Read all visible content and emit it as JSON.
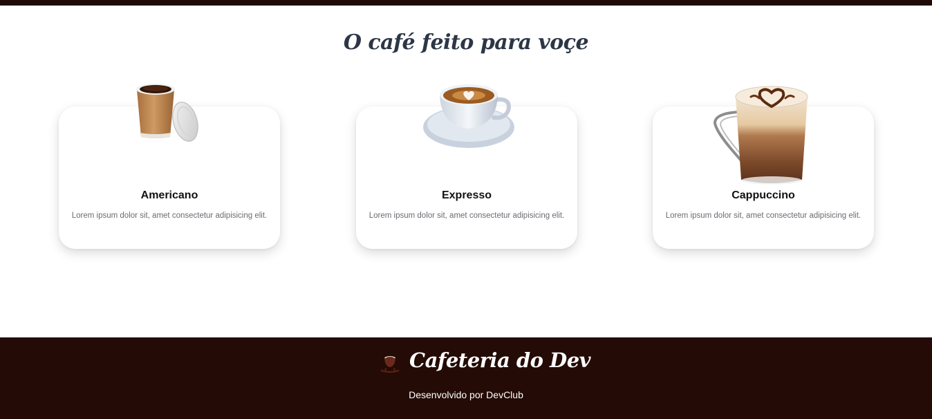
{
  "page": {
    "title": "O café feito para voçe"
  },
  "products": [
    {
      "name": "Americano",
      "description": "Lorem ipsum dolor sit, amet consectetur adipisicing elit.",
      "icon": "coffee-to-go-cup-icon"
    },
    {
      "name": "Expresso",
      "description": "Lorem ipsum dolor sit, amet consectetur adipisicing elit.",
      "icon": "coffee-cup-saucer-icon"
    },
    {
      "name": "Cappuccino",
      "description": "Lorem ipsum dolor sit, amet consectetur adipisicing elit.",
      "icon": "cappuccino-glass-icon"
    }
  ],
  "footer": {
    "brand": "Cafeteria do Dev",
    "credit": "Desenvolvido por DevClub",
    "logo_icon": "coffee-logo-icon"
  },
  "colors": {
    "dark_brown": "#240b05",
    "title_navy": "#2c3646",
    "card_bg": "#ffffff",
    "muted_text": "#6b6b72"
  }
}
